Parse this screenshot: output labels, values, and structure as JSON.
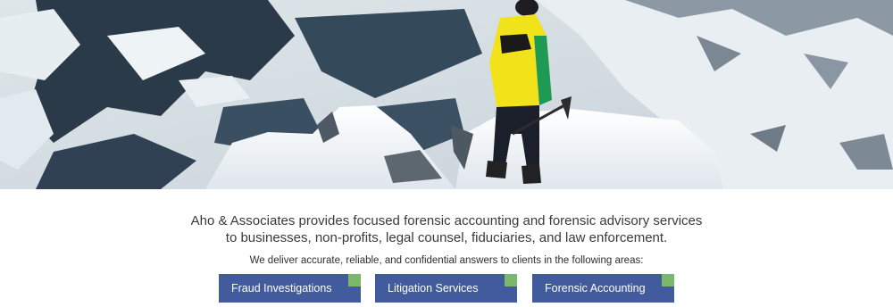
{
  "hero": {
    "scene": "hiker-on-snowy-ridge-photo"
  },
  "intro": {
    "line1": "Aho & Associates provides focused forensic accounting and forensic advisory services",
    "line2": "to businesses, non-profits, legal counsel, fiduciaries, and law enforcement."
  },
  "areas_text": "We deliver accurate, reliable, and confidential answers to clients in the following areas:",
  "services": [
    {
      "label": "Fraud Investigations"
    },
    {
      "label": "Litigation Services"
    },
    {
      "label": "Forensic Accounting"
    }
  ],
  "colors": {
    "button_bg": "#415b9c",
    "button_corner": "#7ab86a",
    "text": "#3a3a3a"
  }
}
